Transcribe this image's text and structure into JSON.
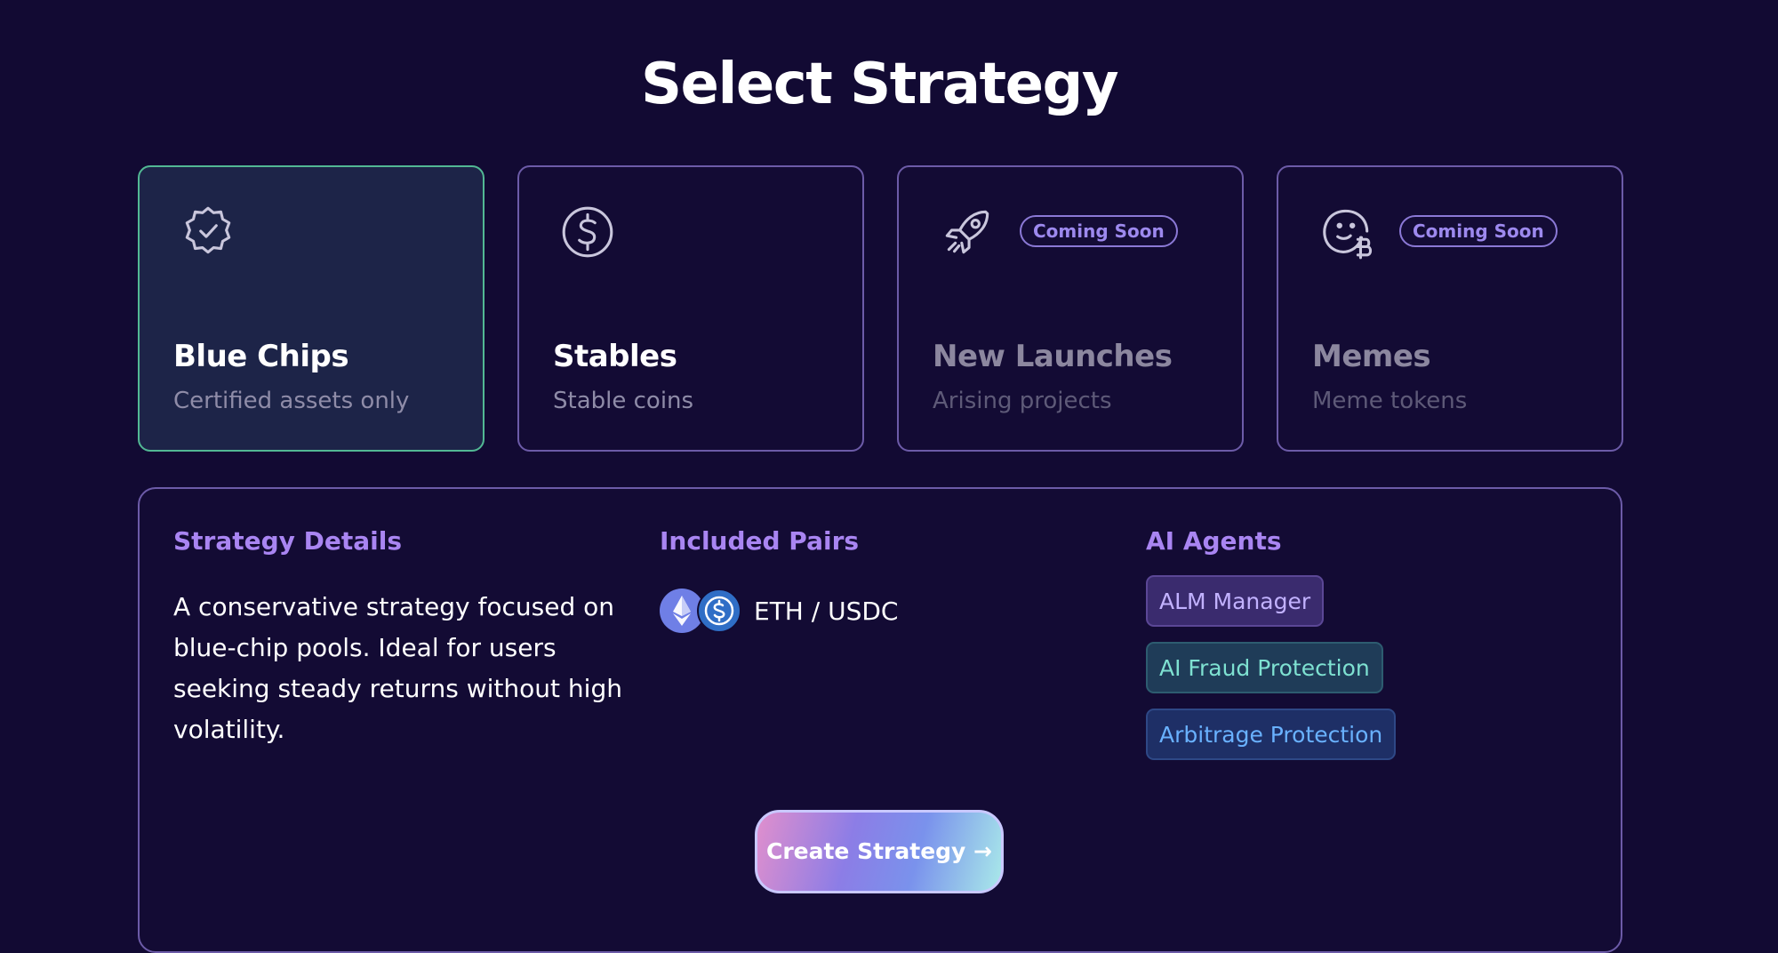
{
  "page": {
    "title": "Select Strategy"
  },
  "strategies": [
    {
      "id": "blue-chips",
      "icon": "verified-badge-icon",
      "title": "Blue Chips",
      "subtitle": "Certified assets only",
      "badge": "",
      "selected": true
    },
    {
      "id": "stables",
      "icon": "dollar-coin-icon",
      "title": "Stables",
      "subtitle": "Stable coins",
      "badge": "",
      "selected": false
    },
    {
      "id": "new-launches",
      "icon": "rocket-icon",
      "title": "New Launches",
      "subtitle": "Arising projects",
      "badge": "Coming Soon",
      "selected": false
    },
    {
      "id": "memes",
      "icon": "smiley-bitcoin-icon",
      "title": "Memes",
      "subtitle": "Meme tokens",
      "badge": "Coming Soon",
      "selected": false
    }
  ],
  "details": {
    "strategy_heading": "Strategy Details",
    "description": "A conservative strategy focused on blue-chip pools. Ideal for users seeking steady returns without high volatility.",
    "pairs_heading": "Included Pairs",
    "pairs": [
      {
        "label": "ETH / USDC",
        "icons": [
          "eth-icon",
          "usdc-icon"
        ]
      }
    ],
    "agents_heading": "AI Agents",
    "agents": [
      {
        "label": "ALM Manager"
      },
      {
        "label": "AI Fraud Protection"
      },
      {
        "label": "Arbitrage Protection"
      }
    ],
    "create_button": "Create Strategy →"
  },
  "colors": {
    "background": "#120a33",
    "card_border": "#6c5ba8",
    "selected_border": "#52b894",
    "heading_accent": "#a985f2"
  }
}
